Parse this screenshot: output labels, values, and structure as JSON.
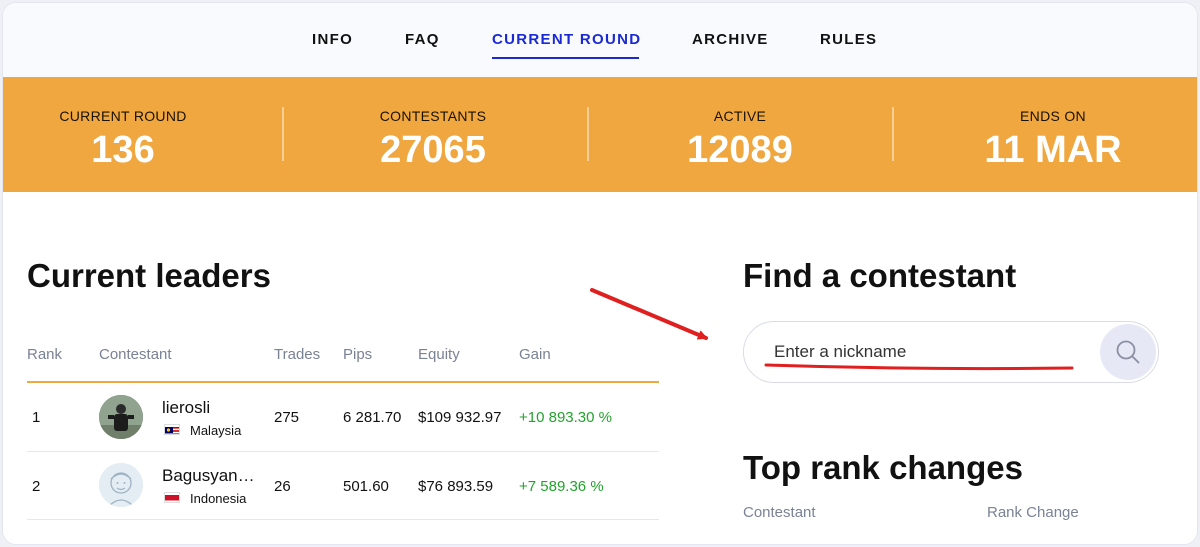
{
  "nav": {
    "items": [
      {
        "label": "INFO",
        "active": false
      },
      {
        "label": "FAQ",
        "active": false
      },
      {
        "label": "CURRENT ROUND",
        "active": true
      },
      {
        "label": "ARCHIVE",
        "active": false
      },
      {
        "label": "RULES",
        "active": false
      }
    ]
  },
  "stats": [
    {
      "label": "CURRENT ROUND",
      "value": "136"
    },
    {
      "label": "CONTESTANTS",
      "value": "27065"
    },
    {
      "label": "ACTIVE",
      "value": "12089"
    },
    {
      "label": "ENDS ON",
      "value": "11 MAR"
    }
  ],
  "leaders": {
    "title": "Current leaders",
    "columns": [
      "Rank",
      "Contestant",
      "Trades",
      "Pips",
      "Equity",
      "Gain"
    ],
    "rows": [
      {
        "rank": "1",
        "name": "lierosli",
        "country": "Malaysia",
        "trades": "275",
        "pips": "6 281.70",
        "equity": "$109 932.97",
        "gain": "+10 893.30 %"
      },
      {
        "rank": "2",
        "name": "Bagusyan…",
        "country": "Indonesia",
        "trades": "26",
        "pips": "501.60",
        "equity": "$76 893.59",
        "gain": "+7 589.36 %"
      }
    ]
  },
  "find": {
    "title": "Find a contestant",
    "placeholder": "Enter a nickname"
  },
  "top_changes": {
    "title": "Top rank changes",
    "columns": [
      "Contestant",
      "Rank Change"
    ]
  },
  "colors": {
    "accent_orange": "#f0a73f",
    "nav_active": "#1a29d4",
    "gain_green": "#23a32d",
    "annotation_red": "#e02020"
  }
}
